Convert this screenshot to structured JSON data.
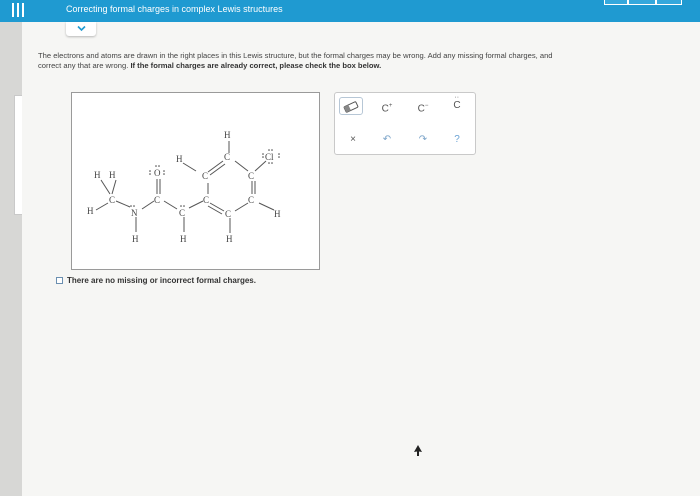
{
  "header": {
    "title": "Correcting formal charges in complex Lewis structures"
  },
  "instructions": {
    "line1": "The electrons and atoms are drawn in the right places in this Lewis structure, but the formal charges may be wrong. Add any missing formal charges, and",
    "line2_prefix": "correct any that are wrong. ",
    "line2_bold": "If the formal charges are already correct, please check the box below."
  },
  "molecule": {
    "atoms": [
      "H",
      "H",
      "H",
      "C",
      "N",
      "O",
      "C",
      "H",
      "C",
      "H",
      "C",
      "C",
      "C",
      "H",
      "H",
      "C",
      "H",
      "C",
      "Cl"
    ],
    "o_label": "O",
    "cl_label": "Cl"
  },
  "checkbox": {
    "label": "There are no missing or incorrect formal charges.",
    "checked": false
  },
  "toolbar": {
    "eraser_icon": "eraser-icon",
    "cplus_label": "C",
    "cplus_sup": "+",
    "cminus_label": "C",
    "cminus_sup": "−",
    "clone_label": "C",
    "clear_symbol": "×",
    "undo_symbol": "↶",
    "redo_symbol": "↷",
    "help_symbol": "?"
  },
  "colors": {
    "topbar": "#1f9ad1",
    "accent": "#6aa2d4"
  }
}
